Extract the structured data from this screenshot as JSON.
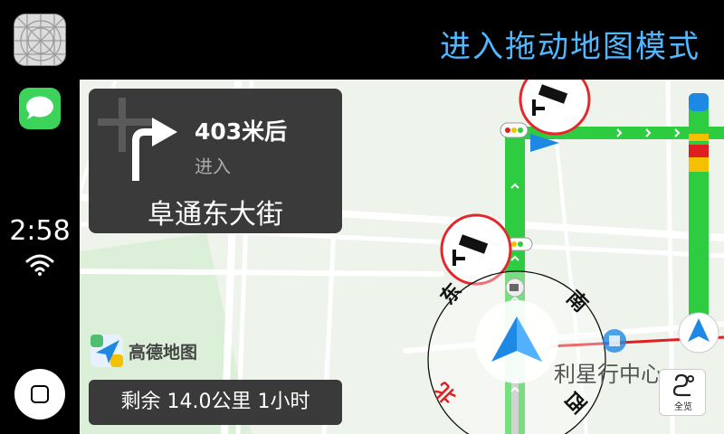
{
  "sidebar": {
    "clock": "2:58",
    "apps": [
      "maps-app",
      "messages-app"
    ]
  },
  "topbar": {
    "drag_mode_label": "进入拖动地图模式"
  },
  "guidance": {
    "distance": "403米后",
    "action": "进入",
    "road_name": "阜通东大街"
  },
  "remaining": {
    "text": "剩余 14.0公里 1小时"
  },
  "logo": {
    "name": "高德地图"
  },
  "map": {
    "poi_label": "利星行中心",
    "compass": {
      "east": "东",
      "south": "南",
      "north": "北",
      "west": "西"
    }
  },
  "overview_button": {
    "label": "全览"
  },
  "colors": {
    "accent": "#4fb8ff",
    "route_green": "#2ecc40",
    "traffic_red": "#e02020",
    "traffic_yellow": "#f5c000",
    "camera_red": "#e5262a",
    "vehicle_blue": "#1e88e5"
  }
}
